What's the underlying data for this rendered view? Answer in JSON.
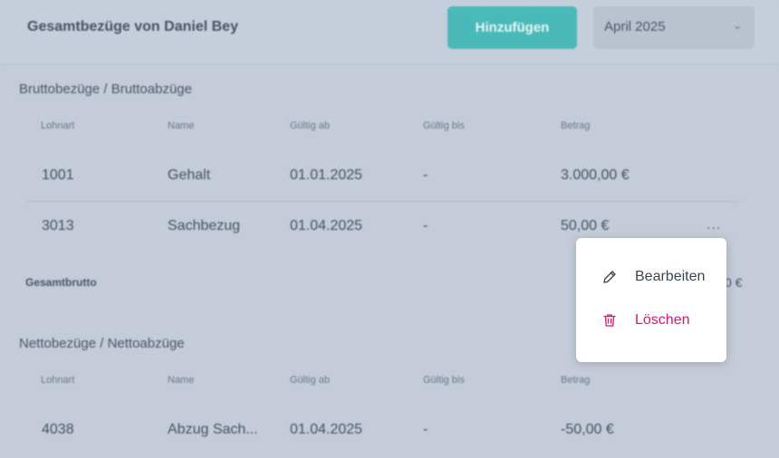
{
  "header": {
    "title": "Gesamtbezüge von Daniel Bey",
    "add_label": "Hinzufügen",
    "month": "April 2025"
  },
  "brutto": {
    "title": "Bruttobezüge / Bruttoabzüge",
    "columns": [
      "Lohnart",
      "Name",
      "Gültig ab",
      "Gültig bis",
      "Betrag"
    ],
    "rows": [
      {
        "lohnart": "1001",
        "name": "Gehalt",
        "from": "01.01.2025",
        "to": "-",
        "amount": "3.000,00 €"
      },
      {
        "lohnart": "3013",
        "name": "Sachbezug",
        "from": "01.04.2025",
        "to": "-",
        "amount": "50,00 €"
      }
    ],
    "total_label": "Gesamtbrutto",
    "total_value_visible": "0 €"
  },
  "netto": {
    "title": "Nettobezüge / Nettoabzüge",
    "columns": [
      "Lohnart",
      "Name",
      "Gültig ab",
      "Gültig bis",
      "Betrag"
    ],
    "rows": [
      {
        "lohnart": "4038",
        "name": "Abzug Sach...",
        "from": "01.04.2025",
        "to": "-",
        "amount": "-50,00 €"
      }
    ]
  },
  "row_menu": {
    "more_label": "...",
    "edit_label": "Bearbeiten",
    "delete_label": "Löschen"
  },
  "icons": {
    "chevron": "chevron-down-icon",
    "edit": "pencil-icon",
    "delete": "trash-icon"
  },
  "colors": {
    "accent": "#4abab9",
    "danger": "#e0176e",
    "overlay_bg": "#c3ccd8"
  }
}
